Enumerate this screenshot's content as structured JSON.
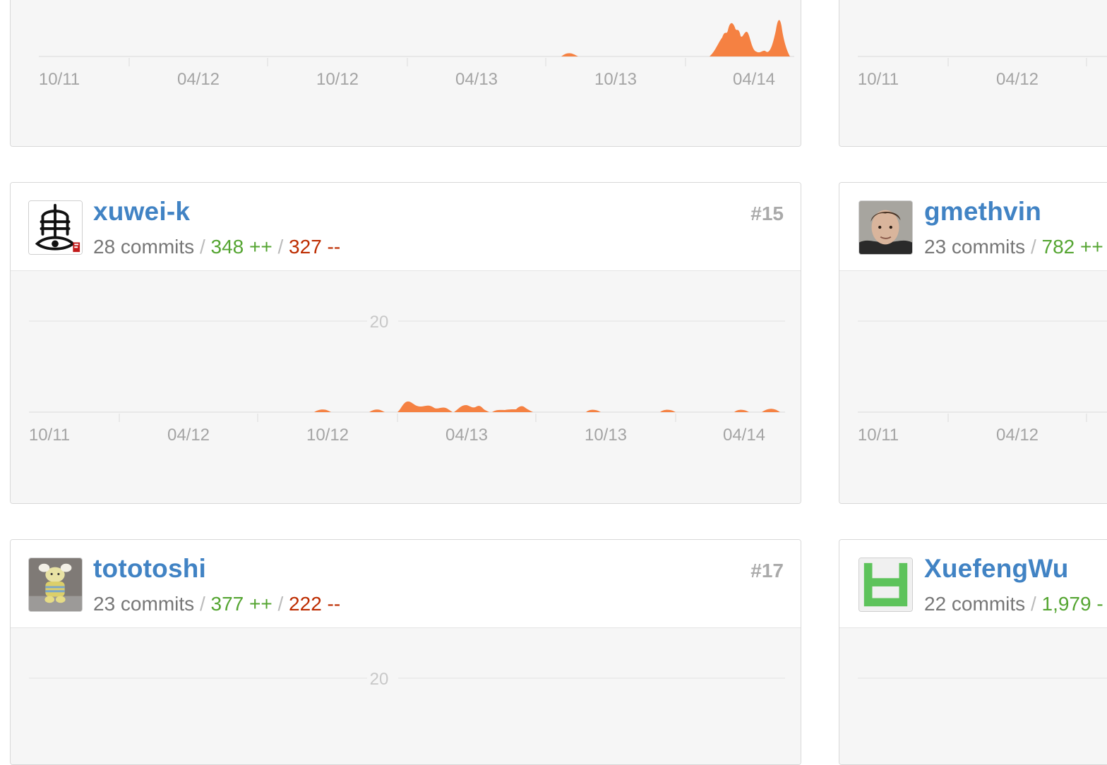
{
  "colors": {
    "link": "#4183c4",
    "additions": "#55a532",
    "deletions": "#bd2c00",
    "area": "#f58142",
    "chart_bg": "#f6f6f6"
  },
  "x_ticks": [
    "10/11",
    "04/12",
    "10/12",
    "04/13",
    "10/13",
    "04/14"
  ],
  "y_tick": "20",
  "sep": "/",
  "top_cards": {
    "left": {
      "x_ticks": [
        "10/11",
        "04/12",
        "10/12",
        "04/13",
        "10/13",
        "04/14"
      ]
    },
    "right": {
      "x_ticks": [
        "10/11",
        "04/12"
      ]
    }
  },
  "contributors": [
    {
      "username": "xuwei-k",
      "rank": "#15",
      "commits": "28 commits",
      "additions": "348 ++",
      "deletions": "327 --",
      "avatar_icon": "eye-glyph-avatar-icon"
    },
    {
      "username": "gmethvin",
      "commits": "23 commits",
      "additions": "782 ++",
      "avatar_icon": "photo-avatar-icon"
    },
    {
      "username": "tototoshi",
      "rank": "#17",
      "commits": "23 commits",
      "additions": "377 ++",
      "deletions": "222 --",
      "avatar_icon": "toy-photo-avatar-icon"
    },
    {
      "username": "XuefengWu",
      "commits": "22 commits",
      "additions": "1,979 -",
      "avatar_icon": "green-identicon-avatar-icon"
    }
  ],
  "chart_data": [
    {
      "type": "area",
      "contributor": "",
      "x_ticks": [
        "10/11",
        "04/12",
        "10/12",
        "04/13",
        "10/13",
        "04/14"
      ],
      "weekly_commits_shape": "peaks near 04/14 only"
    },
    {
      "type": "area",
      "contributor": "xuwei-k",
      "x_ticks": [
        "10/11",
        "04/12",
        "10/12",
        "04/13",
        "10/13",
        "04/14"
      ],
      "y_ticks": [
        "20"
      ]
    },
    {
      "type": "area",
      "contributor": "tototoshi",
      "y_ticks": [
        "20"
      ]
    }
  ]
}
